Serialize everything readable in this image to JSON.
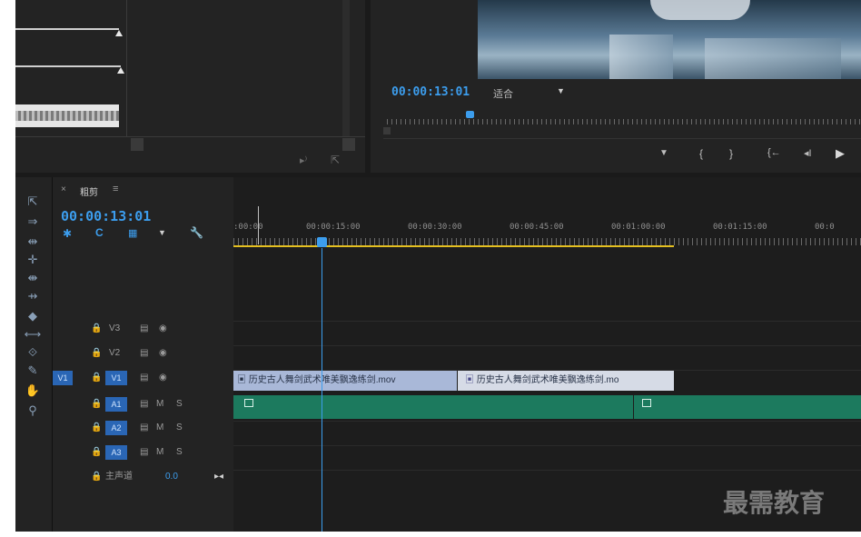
{
  "program": {
    "timecode": "00:00:13:01",
    "fit_label": "适合",
    "fit_arrow": "▼",
    "transport": [
      "▼",
      "{",
      "}",
      "{←",
      "◂I",
      "▶"
    ]
  },
  "timeline": {
    "close_glyph": "×",
    "sequence_name": "粗剪",
    "menu_glyph": "≡",
    "timecode": "00:00:13:01",
    "ruler_ticks": [
      ":00:00",
      "00:00:15:00",
      "00:00:30:00",
      "00:00:45:00",
      "00:01:00:00",
      "00:01:15:00",
      "00:0"
    ],
    "tracks": {
      "v3": "V3",
      "v2": "V2",
      "v1_src": "V1",
      "v1": "V1",
      "a1": "A1",
      "a2": "A2",
      "a3": "A3",
      "m": "M",
      "s": "S",
      "master": "主声道",
      "master_value": "0.0"
    },
    "clips": {
      "clip1": "历史古人舞剑武术唯美飘逸练剑.mov",
      "clip2": "历史古人舞剑武术唯美飘逸练剑.mo"
    }
  },
  "watermark": "最需教育",
  "colors": {
    "accent": "#3c9ded",
    "audio_clip": "#1c7a5e",
    "video_clip": "#a9b8d8",
    "work_area": "#e5c020"
  }
}
